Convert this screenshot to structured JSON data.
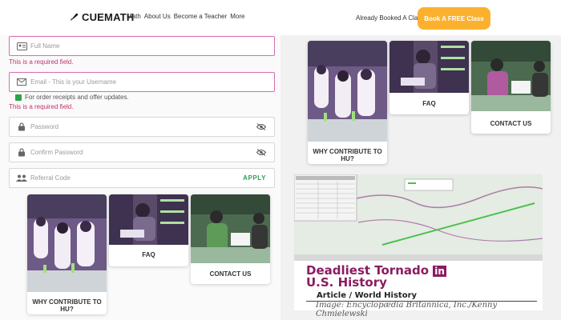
{
  "header": {
    "brand": "CUEMATH",
    "nav": [
      "Math",
      "About Us",
      "Become a Teacher",
      "More"
    ],
    "already_booked": "Already Booked A Class?",
    "book_button": "Book A FREE Class"
  },
  "form": {
    "full_name": {
      "placeholder": "Full Name",
      "error": "This is a required field."
    },
    "email": {
      "placeholder": "Email - This is your Username",
      "hint": "For order receipts and offer updates.",
      "error": "This is a required field."
    },
    "password": {
      "placeholder": "Password"
    },
    "confirm_password": {
      "placeholder": "Confirm Password"
    },
    "referral": {
      "placeholder": "Referral Code",
      "apply": "APPLY"
    }
  },
  "cards_bottom": [
    {
      "label": "WHY CONTRIBUTE TO HU?"
    },
    {
      "label": "FAQ"
    },
    {
      "label": "CONTACT US"
    }
  ],
  "cards_top": [
    {
      "label": "WHY CONTRIBUTE TO HU?"
    },
    {
      "label": "FAQ"
    },
    {
      "label": "CONTACT US"
    }
  ],
  "article": {
    "title_line1": "Deadliest Tornado",
    "title_in": "in",
    "title_line2": "U.S. History",
    "subtitle": "Article / World History",
    "credit": "Image: Encyclopædia Britannica, Inc./Kenny Chmielewski"
  },
  "colors": {
    "accent": "#fbb12e",
    "error": "#c0336f",
    "apply": "#2e9e57",
    "article_title": "#8b1b61"
  }
}
